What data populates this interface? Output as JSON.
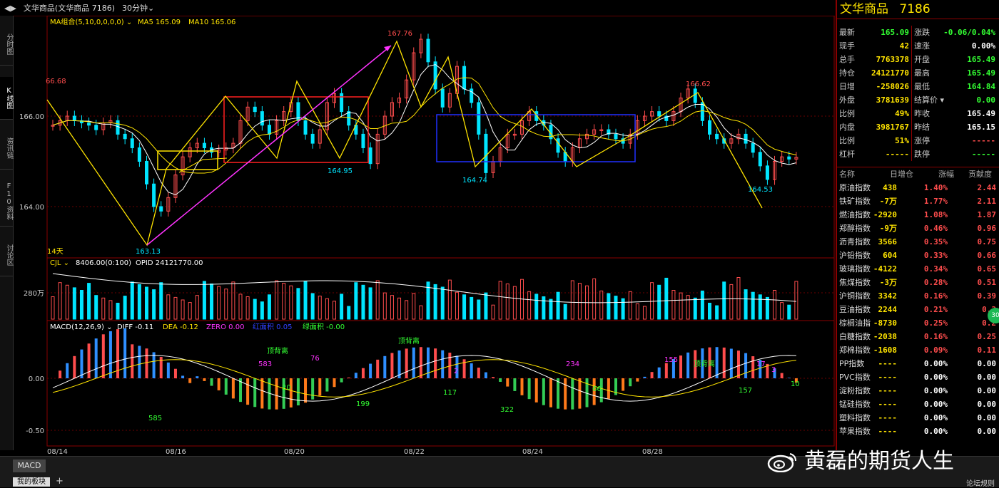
{
  "window": {
    "title": "文华商品(文华商品 7186)",
    "period": "30分钟",
    "left_tabs": [
      "分时图",
      "K线图",
      "资讯链",
      "F10资料",
      "讨论区"
    ],
    "active_tab": "K线图"
  },
  "main_chart": {
    "indicator_label": "MA组合(5,10,0,0,0,0)",
    "ma5_label": "MA5 165.09",
    "ma10_label": "MA10 165.06",
    "y_ticks": [
      "166.00",
      "164.00"
    ],
    "days_label": "14天",
    "annotations": [
      "66.68",
      "167.76",
      "164.95",
      "164.74",
      "166.62",
      "164.53",
      "163.13"
    ]
  },
  "volume_panel": {
    "label": "CJL",
    "vol_text": "8406.00(0:100)",
    "opid_text": "OPID 24121770.00",
    "y_tick": "280万"
  },
  "macd_panel": {
    "label": "MACD(12,26,9)",
    "diff": "DIFF -0.11",
    "dea": "DEA -0.12",
    "zero": "ZERO 0.00",
    "red_area": "红面积 0.05",
    "green_area": "绿面积 -0.00",
    "y_ticks": [
      "0.00",
      "-0.50"
    ],
    "annotations": [
      "585",
      "583",
      "20",
      "76",
      "199",
      "117",
      "322",
      "234",
      "66",
      "155",
      "157",
      "17",
      "3",
      "10",
      "2"
    ],
    "divergence_labels": [
      "顶背离",
      "顶背离",
      "顶背离"
    ]
  },
  "x_axis_labels": [
    "08/14",
    "08/16",
    "08/20",
    "08/22",
    "08/24",
    "08/28"
  ],
  "quote": {
    "name": "文华商品",
    "code": "7186",
    "left": [
      {
        "label": "最新",
        "value": "165.09",
        "color": "dn"
      },
      {
        "label": "现手",
        "value": "42",
        "color": "yl"
      },
      {
        "label": "总手",
        "value": "7763378",
        "color": "yl"
      },
      {
        "label": "持仓",
        "value": "24121770",
        "color": "yl"
      },
      {
        "label": "日增",
        "value": "-258026",
        "color": "yl"
      },
      {
        "label": "外盘",
        "value": "3781639",
        "color": "yl"
      },
      {
        "label": "比例",
        "value": "49%",
        "color": "yl"
      },
      {
        "label": "内盘",
        "value": "3981767",
        "color": "yl"
      },
      {
        "label": "比例",
        "value": "51%",
        "color": "yl"
      },
      {
        "label": "杠杆",
        "value": "-----",
        "color": "yl"
      }
    ],
    "right": [
      {
        "label": "涨跌",
        "value": "-0.06/0.04%",
        "color": "dn"
      },
      {
        "label": "速涨",
        "value": "0.00%",
        "color": "w"
      },
      {
        "label": "开盘",
        "value": "165.49",
        "color": "dn"
      },
      {
        "label": "最高",
        "value": "165.49",
        "color": "dn"
      },
      {
        "label": "最低",
        "value": "164.84",
        "color": "dn"
      },
      {
        "label": "结算价",
        "value": "0.00",
        "color": "dn"
      },
      {
        "label": "昨收",
        "value": "165.49",
        "color": "w"
      },
      {
        "label": "昨结",
        "value": "165.15",
        "color": "w"
      },
      {
        "label": "涨停",
        "value": "-----",
        "color": "up"
      },
      {
        "label": "跌停",
        "value": "-----",
        "color": "dn"
      }
    ]
  },
  "ranking": {
    "headers": [
      "名称",
      "日增仓",
      "涨幅",
      "贡献度"
    ],
    "rows": [
      {
        "name": "原油指数",
        "inc": "438",
        "chg": "1.40%",
        "contrib": "2.44",
        "color": "up"
      },
      {
        "name": "铁矿指数",
        "inc": "-7万",
        "chg": "1.77%",
        "contrib": "2.11",
        "color": "up"
      },
      {
        "name": "燃油指数",
        "inc": "-2920",
        "chg": "1.08%",
        "contrib": "1.87",
        "color": "up"
      },
      {
        "name": "郑醇指数",
        "inc": "-9万",
        "chg": "0.46%",
        "contrib": "0.96",
        "color": "up"
      },
      {
        "name": "沥青指数",
        "inc": "3566",
        "chg": "0.35%",
        "contrib": "0.75",
        "color": "up"
      },
      {
        "name": "沪铅指数",
        "inc": "604",
        "chg": "0.33%",
        "contrib": "0.66",
        "color": "up"
      },
      {
        "name": "玻璃指数",
        "inc": "-4122",
        "chg": "0.34%",
        "contrib": "0.65",
        "color": "up"
      },
      {
        "name": "焦煤指数",
        "inc": "-3万",
        "chg": "0.28%",
        "contrib": "0.51",
        "color": "up"
      },
      {
        "name": "沪铜指数",
        "inc": "3342",
        "chg": "0.16%",
        "contrib": "0.39",
        "color": "up"
      },
      {
        "name": "豆油指数",
        "inc": "2244",
        "chg": "0.21%",
        "contrib": "0.3",
        "color": "up"
      },
      {
        "name": "棕榈油指",
        "inc": "-8730",
        "chg": "0.25%",
        "contrib": "0.2",
        "color": "up"
      },
      {
        "name": "白糖指数",
        "inc": "-2038",
        "chg": "0.16%",
        "contrib": "0.25",
        "color": "up"
      },
      {
        "name": "郑棉指数",
        "inc": "-1608",
        "chg": "0.09%",
        "contrib": "0.11",
        "color": "up"
      },
      {
        "name": "PP指数",
        "inc": "----",
        "chg": "0.00%",
        "contrib": "0.00",
        "color": "w"
      },
      {
        "name": "PVC指数",
        "inc": "----",
        "chg": "0.00%",
        "contrib": "0.00",
        "color": "w"
      },
      {
        "name": "淀粉指数",
        "inc": "----",
        "chg": "0.00%",
        "contrib": "0.00",
        "color": "w"
      },
      {
        "name": "锰硅指数",
        "inc": "----",
        "chg": "0.00%",
        "contrib": "0.00",
        "color": "w"
      },
      {
        "name": "塑料指数",
        "inc": "----",
        "chg": "0.00%",
        "contrib": "0.00",
        "color": "w"
      },
      {
        "name": "苹果指数",
        "inc": "----",
        "chg": "0.00%",
        "contrib": "0.00",
        "color": "w"
      }
    ]
  },
  "bottom": {
    "macd_tab": "MACD",
    "my_block": "我的板块",
    "add": "+",
    "forum": "论坛规则",
    "badge": "30"
  },
  "watermark": "黄磊的期货人生",
  "colors": {
    "up": "#ff4d4d",
    "down": "#33ff33",
    "yellow": "#ffe400",
    "cyan": "#00e5ff",
    "frame": "#8a0000"
  }
}
